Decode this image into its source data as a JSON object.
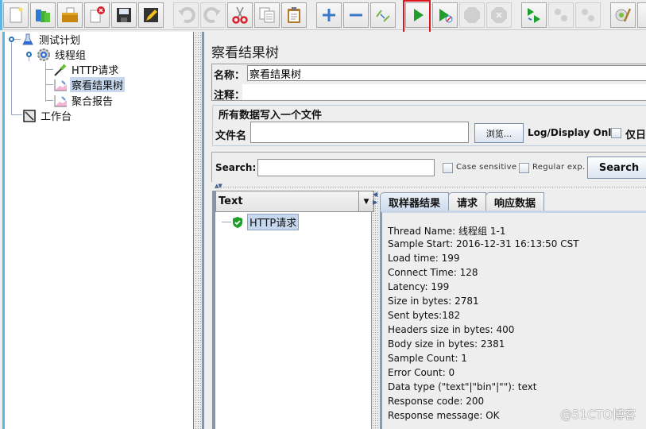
{
  "toolbar": {
    "buttons": [
      {
        "name": "new",
        "icon": "new-file-icon",
        "enabled": true
      },
      {
        "name": "templates",
        "icon": "templates-icon",
        "enabled": true
      },
      {
        "name": "open",
        "icon": "open-folder-icon",
        "enabled": true
      },
      {
        "name": "close",
        "icon": "close-file-icon",
        "enabled": true
      },
      {
        "name": "save",
        "icon": "save-icon",
        "enabled": true
      },
      {
        "name": "save-as",
        "icon": "edit-pencil-icon",
        "enabled": true
      },
      {
        "name": "undo",
        "icon": "undo-icon",
        "enabled": false
      },
      {
        "name": "redo",
        "icon": "redo-icon",
        "enabled": false
      },
      {
        "name": "cut",
        "icon": "scissors-icon",
        "enabled": true
      },
      {
        "name": "copy",
        "icon": "copy-icon",
        "enabled": true
      },
      {
        "name": "paste",
        "icon": "clipboard-icon",
        "enabled": true
      },
      {
        "name": "expand",
        "icon": "plus-icon",
        "enabled": true
      },
      {
        "name": "collapse",
        "icon": "minus-icon",
        "enabled": true
      },
      {
        "name": "toggle",
        "icon": "toggle-icon",
        "enabled": true
      },
      {
        "name": "start",
        "icon": "play-icon",
        "enabled": true
      },
      {
        "name": "start-no-pause",
        "icon": "play-no-timer-icon",
        "enabled": true
      },
      {
        "name": "stop",
        "icon": "stop-icon",
        "enabled": false
      },
      {
        "name": "shutdown",
        "icon": "shutdown-icon",
        "enabled": false
      },
      {
        "name": "remote-start",
        "icon": "remote-start-icon",
        "enabled": true
      },
      {
        "name": "remote-stop",
        "icon": "remote-stop-icon",
        "enabled": false
      },
      {
        "name": "remote-shutdown",
        "icon": "remote-shutdown-icon",
        "enabled": false
      },
      {
        "name": "clear",
        "icon": "broom-gear-icon",
        "enabled": true
      },
      {
        "name": "clear-all",
        "icon": "broom-icon",
        "enabled": true
      }
    ]
  },
  "tree": {
    "items": [
      {
        "label": "测试计划",
        "icon": "flask-icon"
      },
      {
        "label": "线程组",
        "icon": "gear-icon"
      },
      {
        "label": "HTTP请求",
        "icon": "pipette-icon"
      },
      {
        "label": "察看结果树",
        "icon": "chart-icon",
        "selected": true
      },
      {
        "label": "聚合报告",
        "icon": "chart-icon"
      },
      {
        "label": "工作台",
        "icon": "workbench-icon"
      }
    ]
  },
  "panel": {
    "title": "察看结果树",
    "name_label": "名称：",
    "name_value": "察看结果树",
    "comment_label": "注释：",
    "comment_value": "",
    "file_section_title": "所有数据写入一个文件",
    "filename_label": "文件名",
    "filename_value": "",
    "browse_label": "浏览...",
    "log_display_label": "Log/Display Only:",
    "errors_only_label": "仅日"
  },
  "search": {
    "label": "Search:",
    "value": "",
    "case_sensitive_label": "Case sensitive",
    "regex_label": "Regular exp.",
    "button_label": "Search"
  },
  "results": {
    "renderer": "Text",
    "samples": [
      {
        "label": "HTTP请求",
        "status": "success"
      }
    ],
    "tabs": [
      {
        "label": "取样器结果",
        "active": true
      },
      {
        "label": "请求",
        "active": false
      },
      {
        "label": "响应数据",
        "active": false
      }
    ],
    "details": [
      "Thread Name: 线程组 1-1",
      "Sample Start: 2016-12-31 16:13:50 CST",
      "Load time: 199",
      "Connect Time: 128",
      "Latency: 199",
      "Size in bytes: 2781",
      "Sent bytes:182",
      "Headers size in bytes: 400",
      "Body size in bytes: 2381",
      "Sample Count: 1",
      "Error Count: 0",
      "Data type (\"text\"|\"bin\"|\"\"): text",
      "Response code: 200",
      "Response message: OK"
    ]
  },
  "watermark": "@51CTO博客"
}
